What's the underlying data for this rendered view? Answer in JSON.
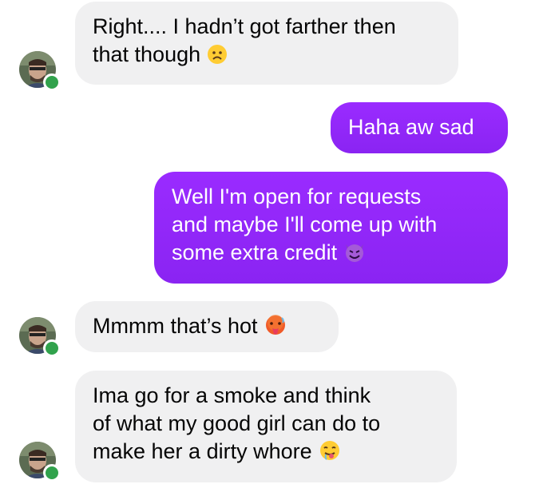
{
  "colors": {
    "incoming_bubble": "#f0f0f1",
    "outgoing_bubble": "#8a24f2",
    "presence": "#31a24c"
  },
  "messages": [
    {
      "direction": "incoming",
      "lines": [
        "Right.... I hadn’t got farther then",
        "that though"
      ],
      "emoji": "frowning-face-emoji"
    },
    {
      "direction": "outgoing",
      "lines": [
        "Haha aw sad"
      ]
    },
    {
      "direction": "outgoing",
      "lines": [
        "Well I'm open for requests",
        "and maybe I'll come up with",
        "some extra credit"
      ],
      "emoji": "smiling-devil-emoji"
    },
    {
      "direction": "incoming",
      "lines": [
        "Mmmm that’s hot"
      ],
      "emoji": "hot-face-emoji"
    },
    {
      "direction": "incoming",
      "lines": [
        "Ima go for a smoke and think",
        "of what my good girl can do to",
        "make her a dirty whore"
      ],
      "emoji": "drooling-face-emoji"
    }
  ]
}
